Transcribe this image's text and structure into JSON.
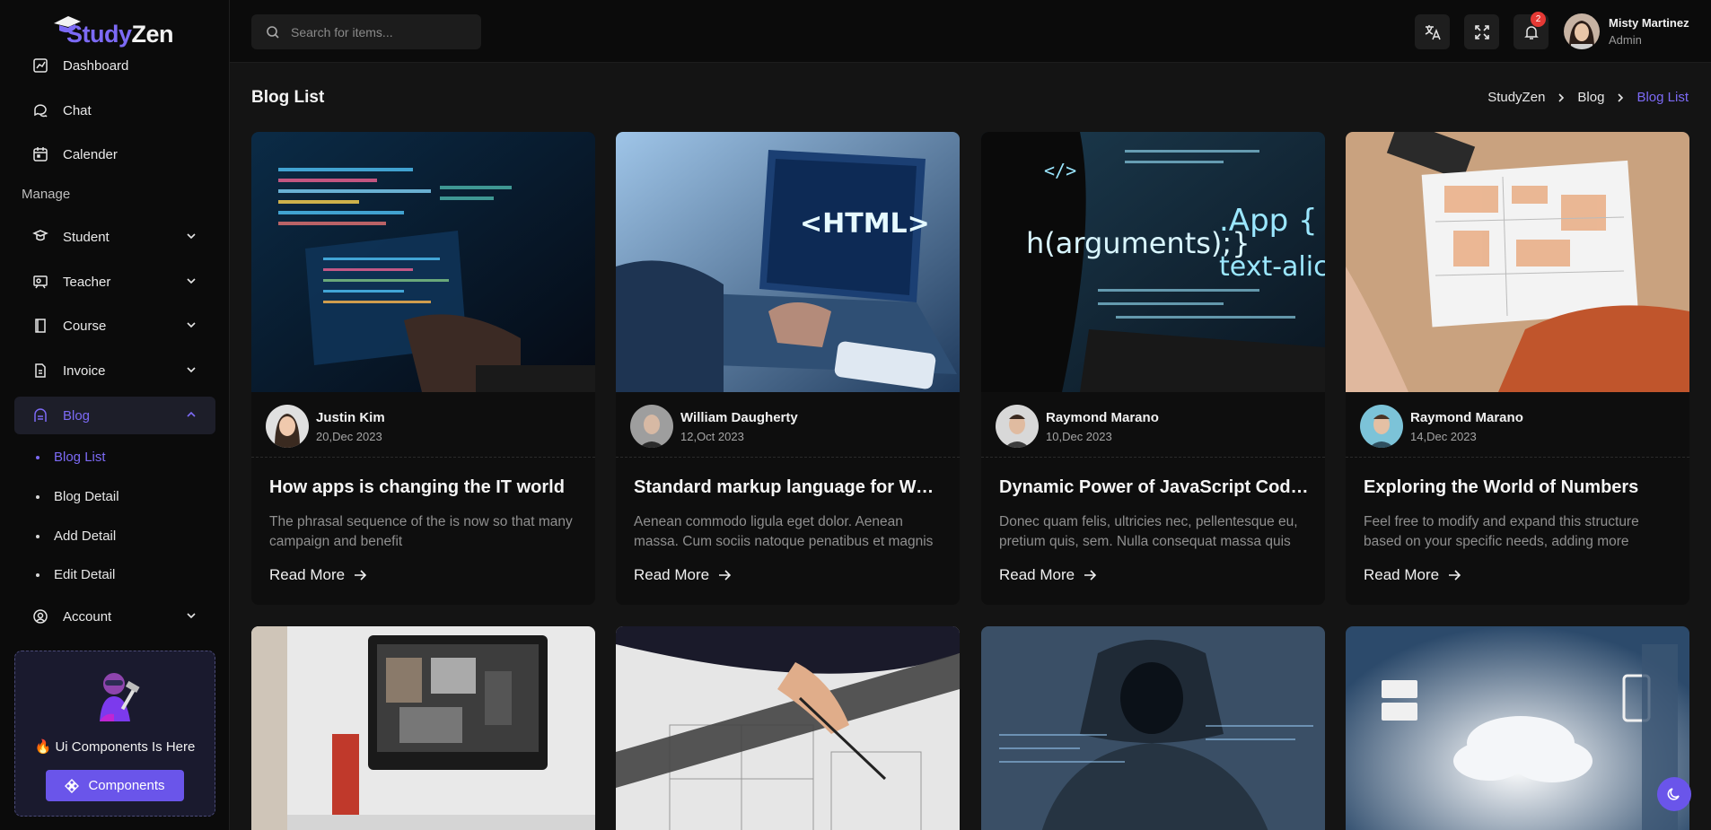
{
  "app": {
    "logo_part1": "Study",
    "logo_part2": "Zen"
  },
  "sidebar": {
    "items_top": [
      {
        "label": "Dashboard",
        "icon": "dashboard-icon"
      },
      {
        "label": "Chat",
        "icon": "chat-icon"
      },
      {
        "label": "Calender",
        "icon": "calendar-icon"
      }
    ],
    "section_label": "Manage",
    "items_manage": [
      {
        "label": "Student",
        "icon": "student-icon"
      },
      {
        "label": "Teacher",
        "icon": "teacher-icon"
      },
      {
        "label": "Course",
        "icon": "course-icon"
      },
      {
        "label": "Invoice",
        "icon": "invoice-icon"
      },
      {
        "label": "Blog",
        "icon": "blog-icon"
      },
      {
        "label": "Account",
        "icon": "account-icon"
      }
    ],
    "blog_subitems": [
      "Blog List",
      "Blog Detail",
      "Add Detail",
      "Edit Detail"
    ],
    "promo_text": "🔥 Ui Components Is Here",
    "promo_button": "Components"
  },
  "header": {
    "search_placeholder": "Search for items...",
    "notification_count": "2",
    "user_name": "Misty Martinez",
    "user_role": "Admin"
  },
  "page": {
    "title": "Blog List",
    "breadcrumb": [
      "StudyZen",
      "Blog",
      "Blog List"
    ]
  },
  "cards": [
    {
      "author": "Justin Kim",
      "date": "20,Dec 2023",
      "title": "How apps is changing the IT world",
      "desc": "The phrasal sequence of the is now so that many campaign and benefit",
      "more": "Read More"
    },
    {
      "author": "William Daugherty",
      "date": "12,Oct 2023",
      "title": "Standard markup language for Web pages",
      "desc": "Aenean commodo ligula eget dolor. Aenean massa. Cum sociis natoque penatibus et magnis dis",
      "more": "Read More"
    },
    {
      "author": "Raymond Marano",
      "date": "10,Dec 2023",
      "title": "Dynamic Power of JavaScript Coding",
      "desc": "Donec quam felis, ultricies nec, pellentesque eu, pretium quis, sem. Nulla consequat massa quis",
      "more": "Read More"
    },
    {
      "author": "Raymond Marano",
      "date": "14,Dec 2023",
      "title": "Exploring the World of Numbers",
      "desc": "Feel free to modify and expand this structure based on your specific needs, adding more sections",
      "more": "Read More"
    }
  ],
  "colors": {
    "accent": "#7c6af5",
    "background": "#141414",
    "sidebar": "#0b0b0b",
    "card": "#0e0e0e"
  }
}
